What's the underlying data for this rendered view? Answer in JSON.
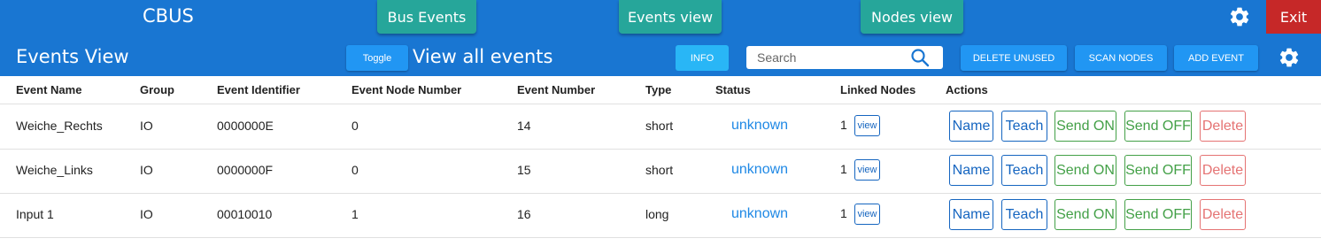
{
  "header": {
    "app_title": "CBUS",
    "nav": [
      {
        "label": "Bus Events"
      },
      {
        "label": "Events view"
      },
      {
        "label": "Nodes view"
      }
    ],
    "exit_label": "Exit"
  },
  "toolbar": {
    "title": "Events View",
    "toggle_label": "Toggle",
    "subtitle": "View all events",
    "info_label": "INFO",
    "search_placeholder": "Search",
    "delete_unused_label": "DELETE UNUSED",
    "scan_nodes_label": "SCAN NODES",
    "add_event_label": "ADD EVENT"
  },
  "table": {
    "columns": [
      "Event Name",
      "Group",
      "Event Identifier",
      "Event Node Number",
      "Event Number",
      "Type",
      "Status",
      "Linked Nodes",
      "Actions"
    ],
    "rows": [
      {
        "name": "Weiche_Rechts",
        "group": "IO",
        "identifier": "0000000E",
        "node_number": "0",
        "event_number": "14",
        "type": "short",
        "status": "unknown",
        "linked": "1"
      },
      {
        "name": "Weiche_Links",
        "group": "IO",
        "identifier": "0000000F",
        "node_number": "0",
        "event_number": "15",
        "type": "short",
        "status": "unknown",
        "linked": "1"
      },
      {
        "name": "Input 1",
        "group": "IO",
        "identifier": "00010010",
        "node_number": "1",
        "event_number": "16",
        "type": "long",
        "status": "unknown",
        "linked": "1"
      }
    ],
    "view_label": "view",
    "actions": {
      "name": "Name",
      "teach": "Teach",
      "send_on": "Send ON",
      "send_off": "Send OFF",
      "delete": "Delete"
    }
  },
  "colors": {
    "header_bg": "#1976d2",
    "nav_button": "#26a69a",
    "exit_button": "#c62828",
    "action_button": "#2196f3",
    "info_button": "#29b6f6",
    "status_text": "#1e88e5",
    "send_green": "#43a047",
    "delete_red": "#e57373"
  },
  "icons": {
    "settings": "gear-icon",
    "search": "search-icon"
  }
}
